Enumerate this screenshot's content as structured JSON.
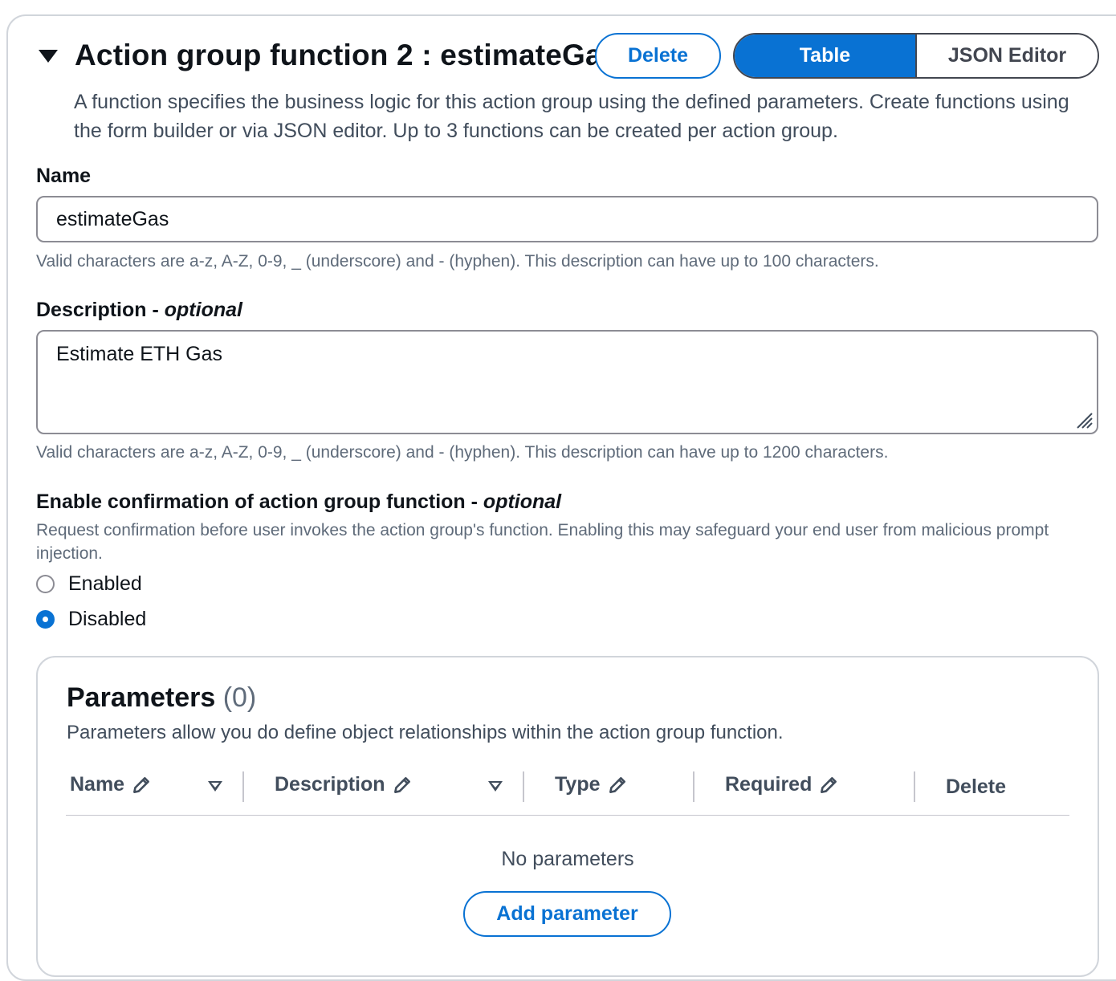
{
  "header": {
    "title": "Action group function 2 : estimateGa",
    "delete_label": "Delete",
    "view_toggle": {
      "table_label": "Table",
      "json_label": "JSON Editor",
      "selected": "Table"
    },
    "description": "A function specifies the business logic for this action group using the defined parameters. Create functions using the form builder or via JSON editor. Up to 3 functions can be created per action group."
  },
  "name_field": {
    "label": "Name",
    "value": "estimateGas",
    "hint": "Valid characters are a-z, A-Z, 0-9, _ (underscore) and - (hyphen). This description can have up to 100 characters."
  },
  "description_field": {
    "label": "Description - ",
    "optional": "optional",
    "value": "Estimate ETH Gas",
    "hint": "Valid characters are a-z, A-Z, 0-9, _ (underscore) and - (hyphen). This description can have up to 1200 characters."
  },
  "confirmation": {
    "label": "Enable confirmation of action group function - ",
    "optional": "optional",
    "description": "Request confirmation before user invokes the action group's function. Enabling this may safeguard your end user from malicious prompt injection.",
    "options": [
      {
        "label": "Enabled",
        "checked": false
      },
      {
        "label": "Disabled",
        "checked": true
      }
    ]
  },
  "parameters": {
    "title": "Parameters",
    "count": "(0)",
    "description": "Parameters allow you do define object relationships within the action group function.",
    "columns": [
      "Name",
      "Description",
      "Type",
      "Required",
      "Delete"
    ],
    "empty_text": "No parameters",
    "add_label": "Add parameter"
  },
  "colors": {
    "accent": "#0972d3",
    "text": "#0f141a",
    "muted": "#5f6b7a"
  }
}
